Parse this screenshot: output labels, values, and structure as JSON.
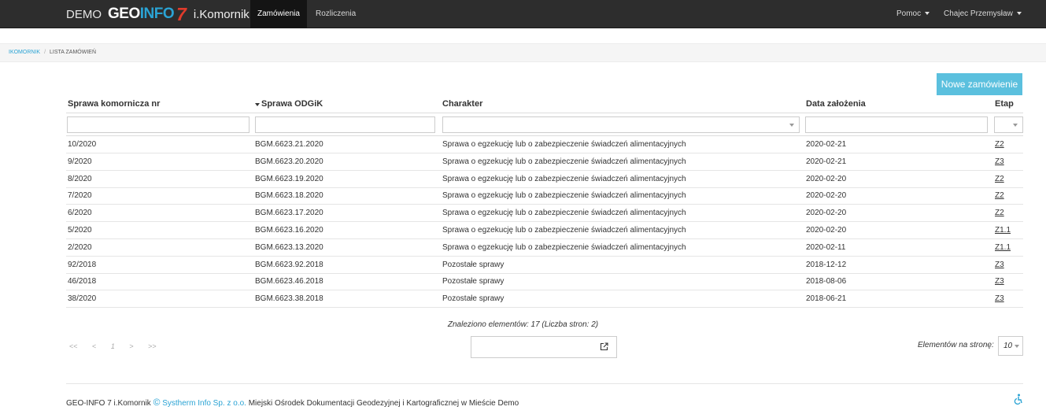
{
  "navbar": {
    "demo": "DEMO",
    "logo_geo": "GEO",
    "logo_info": "INFO",
    "logo_seven": "7",
    "app_name": "i.Komornik",
    "tabs": [
      {
        "label": "Zamówienia",
        "active": true
      },
      {
        "label": "Rozliczenia",
        "active": false
      }
    ],
    "help": "Pomoc",
    "user": "Chajec Przemysław"
  },
  "breadcrumb": {
    "root": "IKOMORNIK",
    "separator": "/",
    "current": "LISTA ZAMÓWIEŃ"
  },
  "new_order_button": "Nowe zamówienie",
  "table": {
    "columns": [
      "Sprawa komornicza nr",
      "Sprawa ODGiK",
      "Charakter",
      "Data założenia",
      "Etap"
    ],
    "rows": [
      {
        "nr": "10/2020",
        "odgik": "BGM.6623.21.2020",
        "charakter": "Sprawa o egzekucję lub o zabezpieczenie świadczeń alimentacyjnych",
        "data": "2020-02-21",
        "etap": "Z2"
      },
      {
        "nr": "9/2020",
        "odgik": "BGM.6623.20.2020",
        "charakter": "Sprawa o egzekucję lub o zabezpieczenie świadczeń alimentacyjnych",
        "data": "2020-02-21",
        "etap": "Z3"
      },
      {
        "nr": "8/2020",
        "odgik": "BGM.6623.19.2020",
        "charakter": "Sprawa o egzekucję lub o zabezpieczenie świadczeń alimentacyjnych",
        "data": "2020-02-20",
        "etap": "Z2"
      },
      {
        "nr": "7/2020",
        "odgik": "BGM.6623.18.2020",
        "charakter": "Sprawa o egzekucję lub o zabezpieczenie świadczeń alimentacyjnych",
        "data": "2020-02-20",
        "etap": "Z2"
      },
      {
        "nr": "6/2020",
        "odgik": "BGM.6623.17.2020",
        "charakter": "Sprawa o egzekucję lub o zabezpieczenie świadczeń alimentacyjnych",
        "data": "2020-02-20",
        "etap": "Z2"
      },
      {
        "nr": "5/2020",
        "odgik": "BGM.6623.16.2020",
        "charakter": "Sprawa o egzekucję lub o zabezpieczenie świadczeń alimentacyjnych",
        "data": "2020-02-20",
        "etap": "Z1.1"
      },
      {
        "nr": "2/2020",
        "odgik": "BGM.6623.13.2020",
        "charakter": "Sprawa o egzekucję lub o zabezpieczenie świadczeń alimentacyjnych",
        "data": "2020-02-11",
        "etap": "Z1.1"
      },
      {
        "nr": "92/2018",
        "odgik": "BGM.6623.92.2018",
        "charakter": "Pozostałe sprawy",
        "data": "2018-12-12",
        "etap": "Z3"
      },
      {
        "nr": "46/2018",
        "odgik": "BGM.6623.46.2018",
        "charakter": "Pozostałe sprawy",
        "data": "2018-08-06",
        "etap": "Z3"
      },
      {
        "nr": "38/2020",
        "odgik": "BGM.6623.38.2018",
        "charakter": "Pozostałe sprawy",
        "data": "2018-06-21",
        "etap": "Z3"
      }
    ]
  },
  "pagination": {
    "found_text": "Znaleziono elementów: 17 (Liczba stron: 2)",
    "first": "<<",
    "prev": "<",
    "current_page": "1",
    "next": ">",
    "last": ">>",
    "per_page_label": "Elementów na stronę:",
    "per_page_value": "10"
  },
  "footer": {
    "prefix": "GEO-INFO 7 i.Komornik",
    "copyright": "©",
    "company": "Systherm Info Sp. z o.o.",
    "suffix": "Miejski Ośrodek Dokumentacji Geodezyjnej i Kartograficznej w Mieście Demo"
  },
  "colors": {
    "navbar_bg": "#2d2d2d",
    "accent": "#2aa3d4",
    "button": "#5bc0de",
    "logo_seven": "#e03b2b"
  }
}
